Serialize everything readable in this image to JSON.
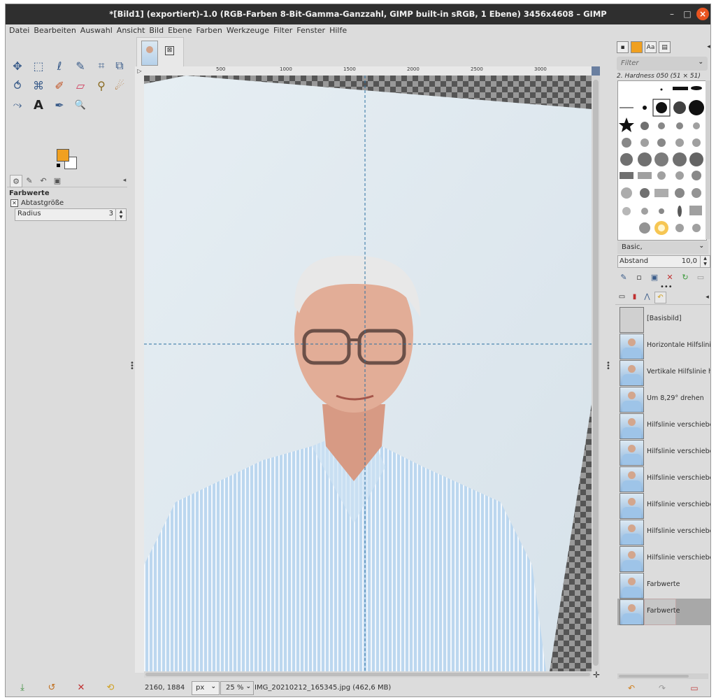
{
  "window": {
    "title": "*[Bild1] (exportiert)-1.0 (RGB-Farben 8-Bit-Gamma-Ganzzahl, GIMP built-in sRGB, 1 Ebene) 3456x4608 – GIMP",
    "minimize_glyph": "–",
    "maximize_glyph": "□",
    "close_glyph": "×"
  },
  "menu": [
    "Datei",
    "Bearbeiten",
    "Auswahl",
    "Ansicht",
    "Bild",
    "Ebene",
    "Farben",
    "Werkzeuge",
    "Filter",
    "Fenster",
    "Hilfe"
  ],
  "colors": {
    "foreground": "#f0a020",
    "background": "#ffffff",
    "accent_close": "#e95420",
    "guide": "#2a6fa0"
  },
  "tools": [
    {
      "name": "move-tool-icon",
      "glyph": "✥"
    },
    {
      "name": "rect-select-icon",
      "glyph": "⬚"
    },
    {
      "name": "free-select-icon",
      "glyph": "ℓ"
    },
    {
      "name": "fuzzy-select-icon",
      "glyph": "✎"
    },
    {
      "name": "crop-icon",
      "glyph": "⌗"
    },
    {
      "name": "transform-icon",
      "glyph": "⧉"
    },
    {
      "name": "warp-icon",
      "glyph": "⥀"
    },
    {
      "name": "cage-icon",
      "glyph": "⌘"
    },
    {
      "name": "paintbrush-icon",
      "glyph": "✐"
    },
    {
      "name": "eraser-icon",
      "glyph": "▱"
    },
    {
      "name": "clone-icon",
      "glyph": "⚲"
    },
    {
      "name": "smudge-icon",
      "glyph": "☄"
    },
    {
      "name": "paths-icon",
      "glyph": "⤳"
    },
    {
      "name": "text-tool-icon",
      "glyph": "A"
    },
    {
      "name": "color-picker-icon",
      "glyph": "✒"
    },
    {
      "name": "zoom-icon",
      "glyph": "🔍"
    }
  ],
  "tool_options": {
    "title": "Farbwerte",
    "sample_size_label": "Abtastgröße",
    "radius_label": "Radius",
    "radius_value": "3"
  },
  "image": {
    "thumb_close": "⊠",
    "ruler_ticks": [
      "500",
      "1000",
      "1500",
      "2000",
      "2500",
      "3000"
    ]
  },
  "status": {
    "coords": "2160, 1884",
    "unit": "px",
    "zoom": "25 %",
    "file_info": "IMG_20210212_165345.jpg (462,6 MB)"
  },
  "brushes": {
    "filter_placeholder": "Filter",
    "selected_brush": "2. Hardness 050 (51 × 51)",
    "brush_set": "Basic,",
    "spacing_label": "Abstand",
    "spacing_value": "10,0"
  },
  "history": {
    "items": [
      {
        "label": "[Basisbild]",
        "plain": true
      },
      {
        "label": "Horizontale Hilfslinie hi"
      },
      {
        "label": "Vertikale Hilfslinie hinzu"
      },
      {
        "label": "Um 8,29° drehen"
      },
      {
        "label": "Hilfslinie verschieben"
      },
      {
        "label": "Hilfslinie verschieben"
      },
      {
        "label": "Hilfslinie verschieben"
      },
      {
        "label": "Hilfslinie verschieben"
      },
      {
        "label": "Hilfslinie verschieben"
      },
      {
        "label": "Hilfslinie verschieben"
      },
      {
        "label": "Farbwerte"
      },
      {
        "label": "Farbwerte",
        "selected": true
      }
    ]
  }
}
